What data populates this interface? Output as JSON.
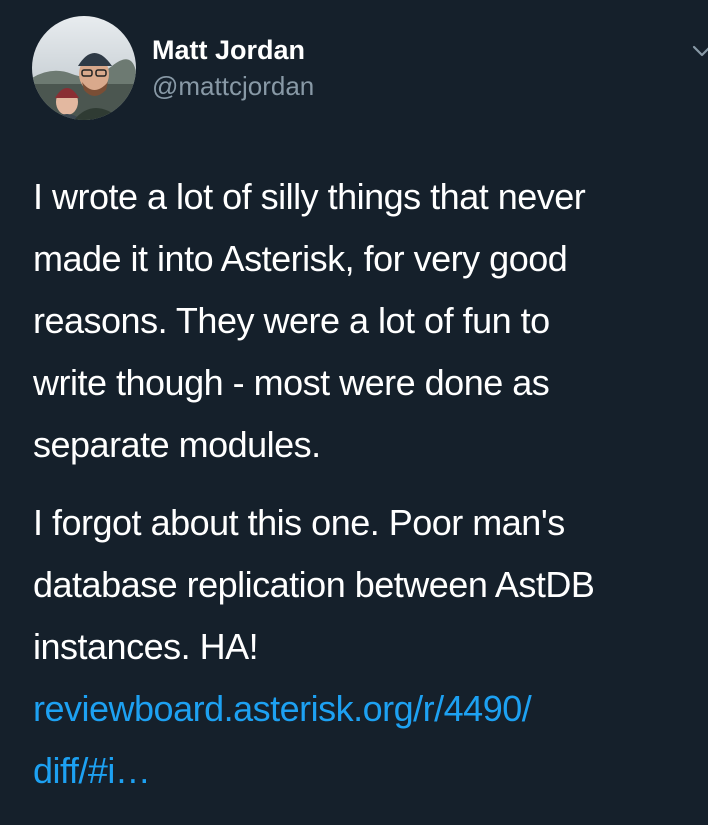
{
  "author": {
    "display_name": "Matt Jordan",
    "handle": "@mattcjordan"
  },
  "tweet": {
    "paragraph_1_lines": [
      "I wrote a lot of silly things that never",
      "made it into Asterisk, for very good",
      "reasons. They were a lot of fun to",
      "write though - most were done as",
      "separate modules."
    ],
    "paragraph_2_lines": [
      "I forgot about this one. Poor man's",
      "database replication between AstDB",
      "instances. HA!"
    ],
    "link_lines": [
      "reviewboard.asterisk.org/r/4490/",
      "diff/#i…"
    ]
  },
  "icons": {
    "avatar": "profile-photo",
    "caret": "chevron-down-icon"
  },
  "colors": {
    "background": "#15202b",
    "text": "#ffffff",
    "secondary": "#8899a6",
    "link": "#1da1f2"
  }
}
